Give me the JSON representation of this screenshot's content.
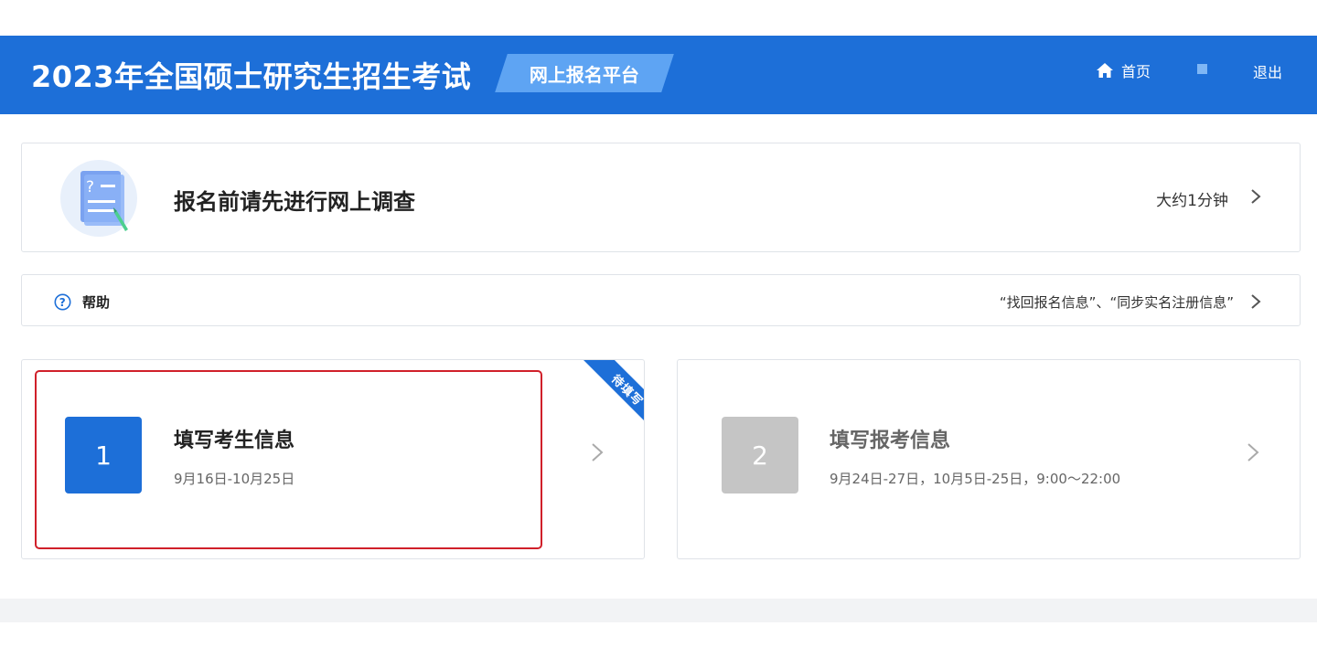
{
  "header": {
    "title": "2023年全国硕士研究生招生考试",
    "platform_tag": "网上报名平台",
    "nav": {
      "home_label": "首页",
      "logout_label": "退出"
    }
  },
  "survey": {
    "title": "报名前请先进行网上调查",
    "duration": "大约1分钟"
  },
  "help": {
    "label": "帮助",
    "links": "“找回报名信息”、“同步实名注册信息”"
  },
  "steps": [
    {
      "number": "1",
      "title": "填写考生信息",
      "dates": "9月16日-10月25日",
      "ribbon": "待填写"
    },
    {
      "number": "2",
      "title": "填写报考信息",
      "dates": "9月24日-27日，10月5日-25日，9:00～22:00"
    }
  ],
  "colors": {
    "primary": "#1d6fd8",
    "highlight_border": "#d0202a",
    "disabled": "#c5c5c5"
  }
}
